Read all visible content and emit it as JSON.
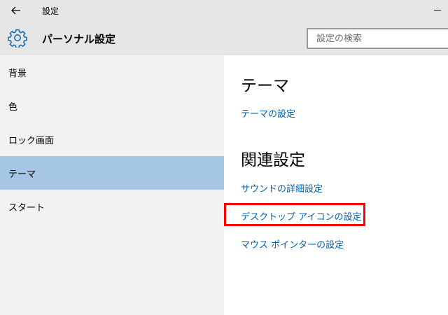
{
  "window": {
    "title": "設定"
  },
  "header": {
    "title": "パーソナル設定",
    "search_placeholder": "設定の検索"
  },
  "sidebar": {
    "items": [
      {
        "label": "背景"
      },
      {
        "label": "色"
      },
      {
        "label": "ロック画面"
      },
      {
        "label": "テーマ",
        "selected": true
      },
      {
        "label": "スタート"
      }
    ]
  },
  "main": {
    "section_title": "テーマ",
    "theme_settings_link": "テーマの設定",
    "related_title": "関連設定",
    "related_links": [
      {
        "label": "サウンドの詳細設定"
      },
      {
        "label": "デスクトップ アイコンの設定",
        "highlighted": true
      },
      {
        "label": "マウス ポインターの設定"
      }
    ]
  },
  "colors": {
    "accent_link": "#0063b1",
    "selection": "#a5c6e4",
    "highlight": "#ff0000"
  },
  "icons": {
    "back": "back-arrow-icon",
    "settings": "gear-icon"
  }
}
